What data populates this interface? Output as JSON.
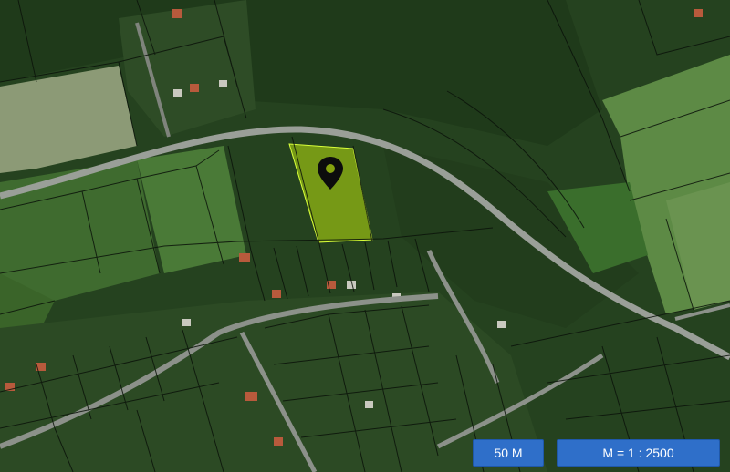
{
  "map": {
    "view": "satellite",
    "overlay": "cadastral parcel boundaries",
    "selected_parcel_color": "#b9e20f",
    "marker_icon": "location-pin-icon",
    "road_color": "#9a9f98"
  },
  "scale": {
    "bar_label": "50 M",
    "ratio_label": "M = 1 : 2500",
    "bar_color": "#2f6fc9"
  }
}
